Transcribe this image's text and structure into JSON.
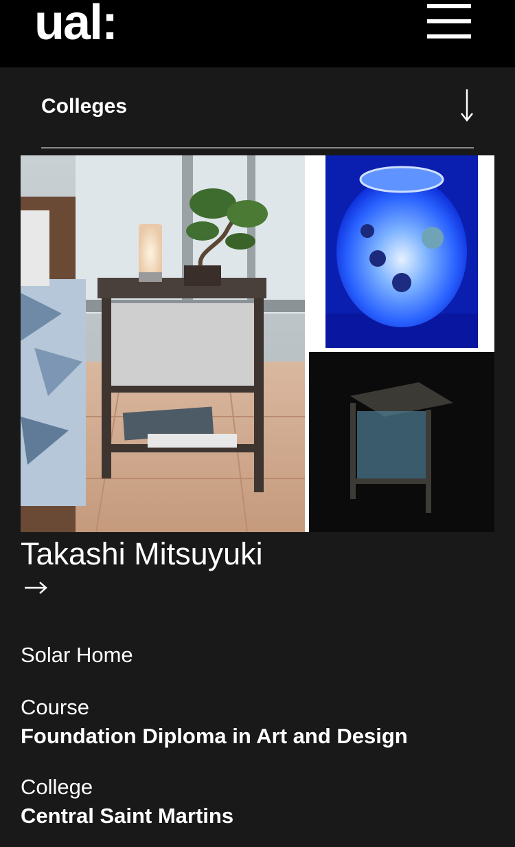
{
  "header": {
    "logo": "ual:",
    "menu_icon": "hamburger-menu-icon"
  },
  "nav": {
    "colleges_label": "Colleges",
    "toggle_icon": "arrow-down-icon"
  },
  "profile": {
    "name": "Takashi Mitsuyuki",
    "link_icon": "arrow-right-icon",
    "project_title": "Solar Home",
    "course_label": "Course",
    "course_value": "Foundation Diploma in Art and Design",
    "college_label": "College",
    "college_value": "Central Saint Martins"
  },
  "colors": {
    "header_bg": "#000000",
    "page_bg": "#191919",
    "text": "#ffffff",
    "divider": "#8a8a8a"
  }
}
